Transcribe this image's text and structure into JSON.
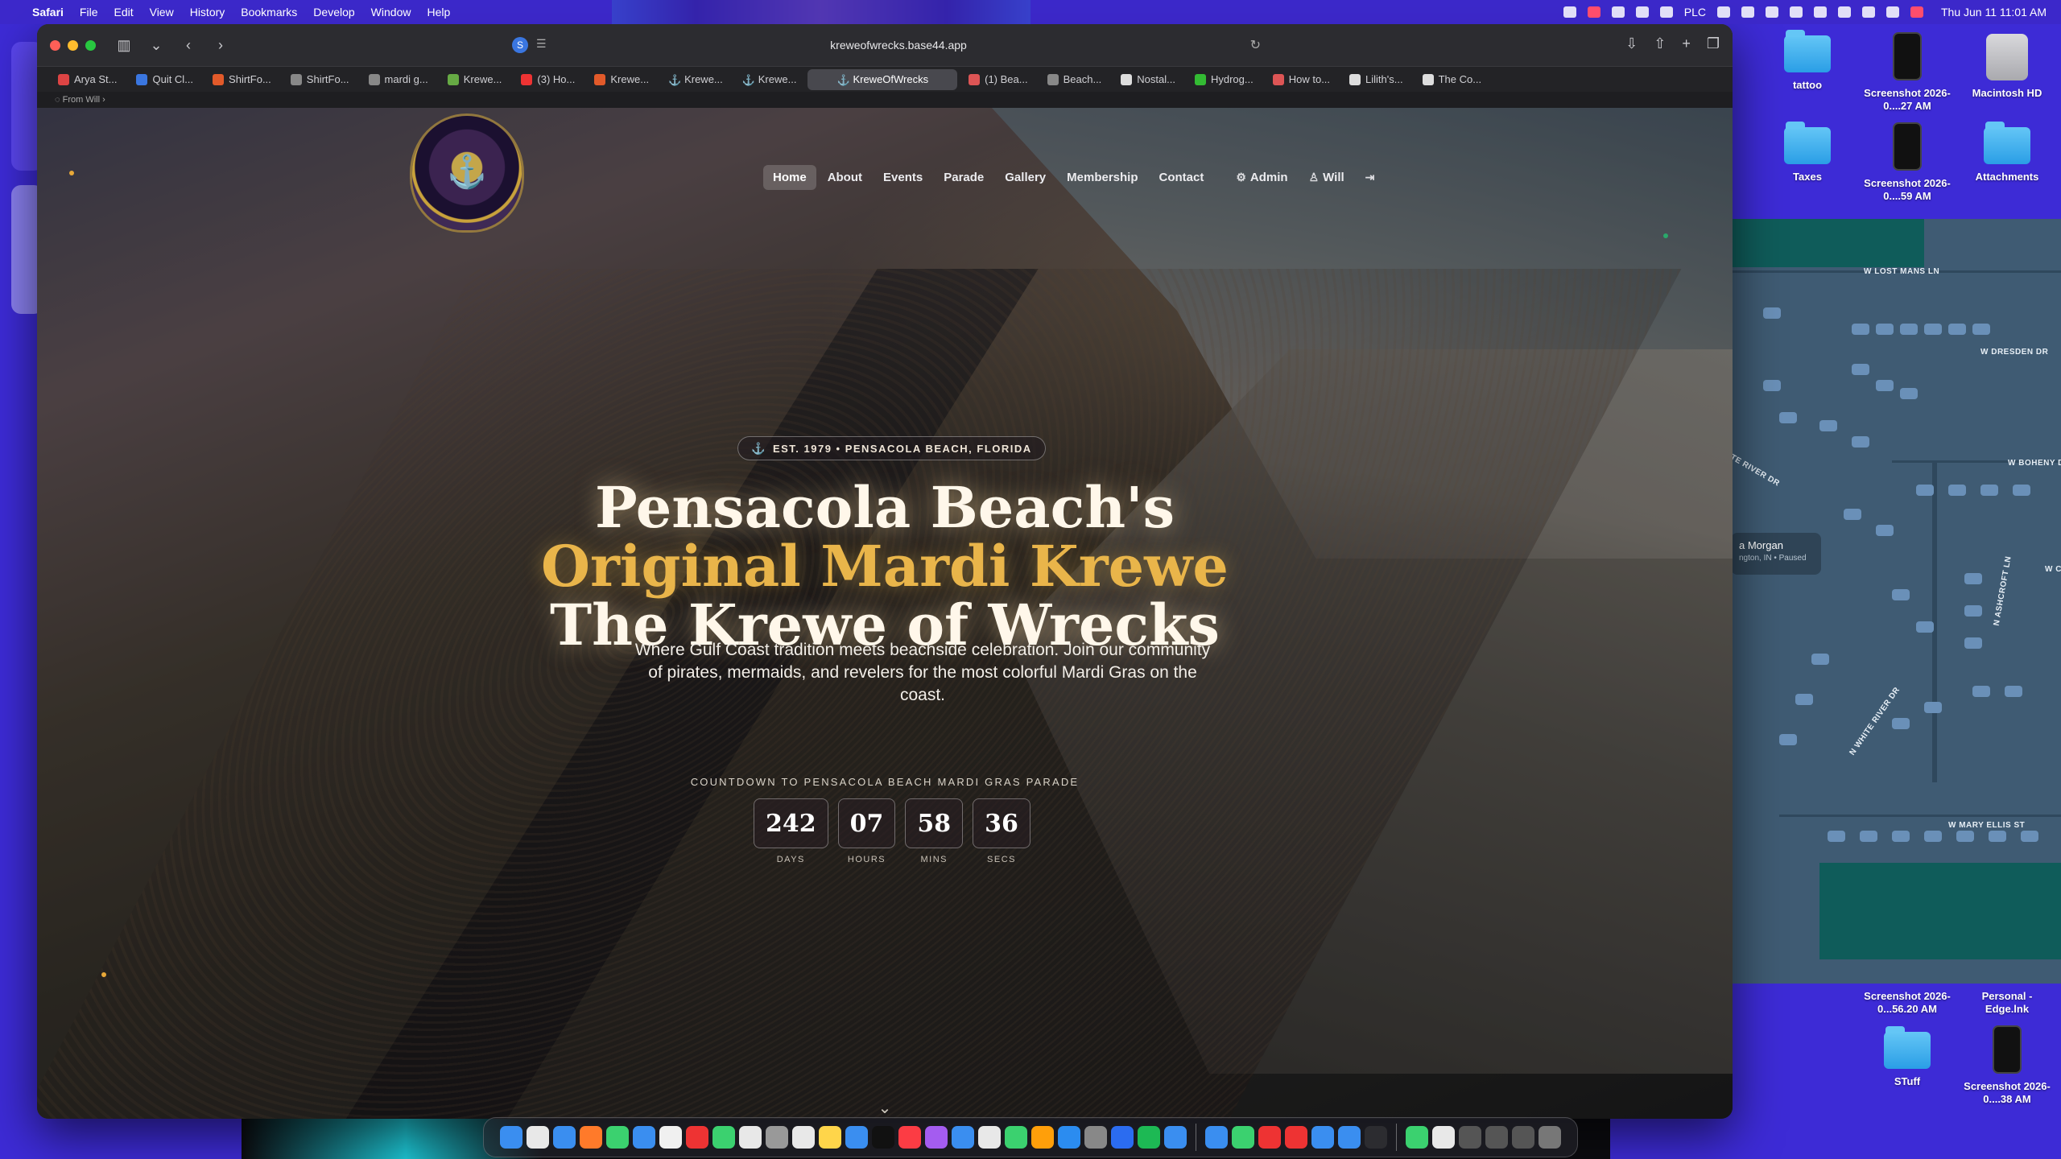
{
  "menubar": {
    "app": "Safari",
    "items": [
      "File",
      "Edit",
      "View",
      "History",
      "Bookmarks",
      "Develop",
      "Window",
      "Help"
    ],
    "status_text": "PLC",
    "clock": "Thu Jun 11  11:01 AM"
  },
  "safari": {
    "url": "kreweofwrecks.base44.app",
    "tabs": [
      {
        "label": "Arya St...",
        "color": "#d44"
      },
      {
        "label": "Quit Cl...",
        "color": "#3a76e0"
      },
      {
        "label": "ShirtFo...",
        "color": "#e25a2a"
      },
      {
        "label": "ShirtFo...",
        "color": "#888"
      },
      {
        "label": "mardi g...",
        "color": "#888"
      },
      {
        "label": "Krewe...",
        "color": "#6a4"
      },
      {
        "label": "(3) Ho...",
        "color": "#e33"
      },
      {
        "label": "Krewe...",
        "color": "#e25a2a"
      },
      {
        "label": "Krewe...",
        "color": "#aaa"
      },
      {
        "label": "Krewe...",
        "color": "#aaa"
      },
      {
        "label": "KreweOfWrecks",
        "color": "#aaa",
        "active": true
      },
      {
        "label": "(1) Bea...",
        "color": "#d55"
      },
      {
        "label": "Beach...",
        "color": "#888"
      },
      {
        "label": "Nostal...",
        "color": "#ddd"
      },
      {
        "label": "Hydrog...",
        "color": "#3b3"
      },
      {
        "label": "How to...",
        "color": "#d55"
      },
      {
        "label": "Lilith's...",
        "color": "#ddd"
      },
      {
        "label": "The Co...",
        "color": "#ddd"
      }
    ],
    "bookmark_hint": "From Will"
  },
  "site": {
    "nav": [
      "Home",
      "About",
      "Events",
      "Parade",
      "Gallery",
      "Membership",
      "Contact"
    ],
    "admin_label": "Admin",
    "user_label": "Will",
    "badge": "EST. 1979 • PENSACOLA BEACH, FLORIDA",
    "title_line1": "Pensacola Beach's",
    "title_line2": "Original Mardi Krewe",
    "title_line3": "The Krewe of Wrecks",
    "subtitle": "Where Gulf Coast tradition meets beachside celebration. Join our community of pirates, mermaids, and revelers for the most colorful Mardi Gras on the coast.",
    "countdown_label": "COUNTDOWN TO PENSACOLA BEACH MARDI GRAS PARADE",
    "countdown": [
      {
        "value": "242",
        "unit": "DAYS"
      },
      {
        "value": "07",
        "unit": "HOURS"
      },
      {
        "value": "58",
        "unit": "MINS"
      },
      {
        "value": "36",
        "unit": "SECS"
      }
    ]
  },
  "maps": {
    "streets": [
      "W LOST MANS LN",
      "W DRESDEN DR",
      "W BOHENY DR",
      "N ASHCROFT LN",
      "N WHITE RIVER DR",
      "W MARY ELLIS ST",
      "TE RIVER DR",
      "W C"
    ],
    "card_name": "a Morgan",
    "card_sub": "ngton, IN • Paused"
  },
  "desktop_icons": [
    {
      "label": "tattoo",
      "kind": "folder"
    },
    {
      "label": "Screenshot 2026-0....27 AM",
      "kind": "phone"
    },
    {
      "label": "Macintosh HD",
      "kind": "drive"
    },
    {
      "label": "Taxes",
      "kind": "folder"
    },
    {
      "label": "Screenshot 2026-0....59 AM",
      "kind": "phone"
    },
    {
      "label": "Attachments",
      "kind": "folder"
    },
    {
      "label": "Screenshot 2026-0...56.20 AM",
      "kind": "none"
    },
    {
      "label": "Personal - Edge.lnk",
      "kind": "none"
    },
    {
      "label": "STuff",
      "kind": "folder"
    },
    {
      "label": "Screenshot 2026-0....38 AM",
      "kind": "phone"
    }
  ],
  "dock_colors": [
    "#3a8ef0",
    "#e8e8e8",
    "#3a8ef0",
    "#ff7a2a",
    "#3bd16f",
    "#3a8ef0",
    "#f0f0f0",
    "#e33",
    "#3bd16f",
    "#e8e8e8",
    "#999",
    "#e8e8e8",
    "#ffd54a",
    "#3a8ef0",
    "#111",
    "#fc3c44",
    "#a45cf0",
    "#3a8ef0",
    "#e8e8e8",
    "#3bd16f",
    "#ff9f0a",
    "#2b8cf0",
    "#888",
    "#2b6cf0",
    "#1db954",
    "#3a8ef0",
    "#3a8ef0",
    "#3bd16f",
    "#e33",
    "#e33",
    "#3a8ef0",
    "#3a8ef0",
    "#2c2c30",
    "#3bd16f",
    "#e8e8e8",
    "#555",
    "#555",
    "#555",
    "#777"
  ]
}
